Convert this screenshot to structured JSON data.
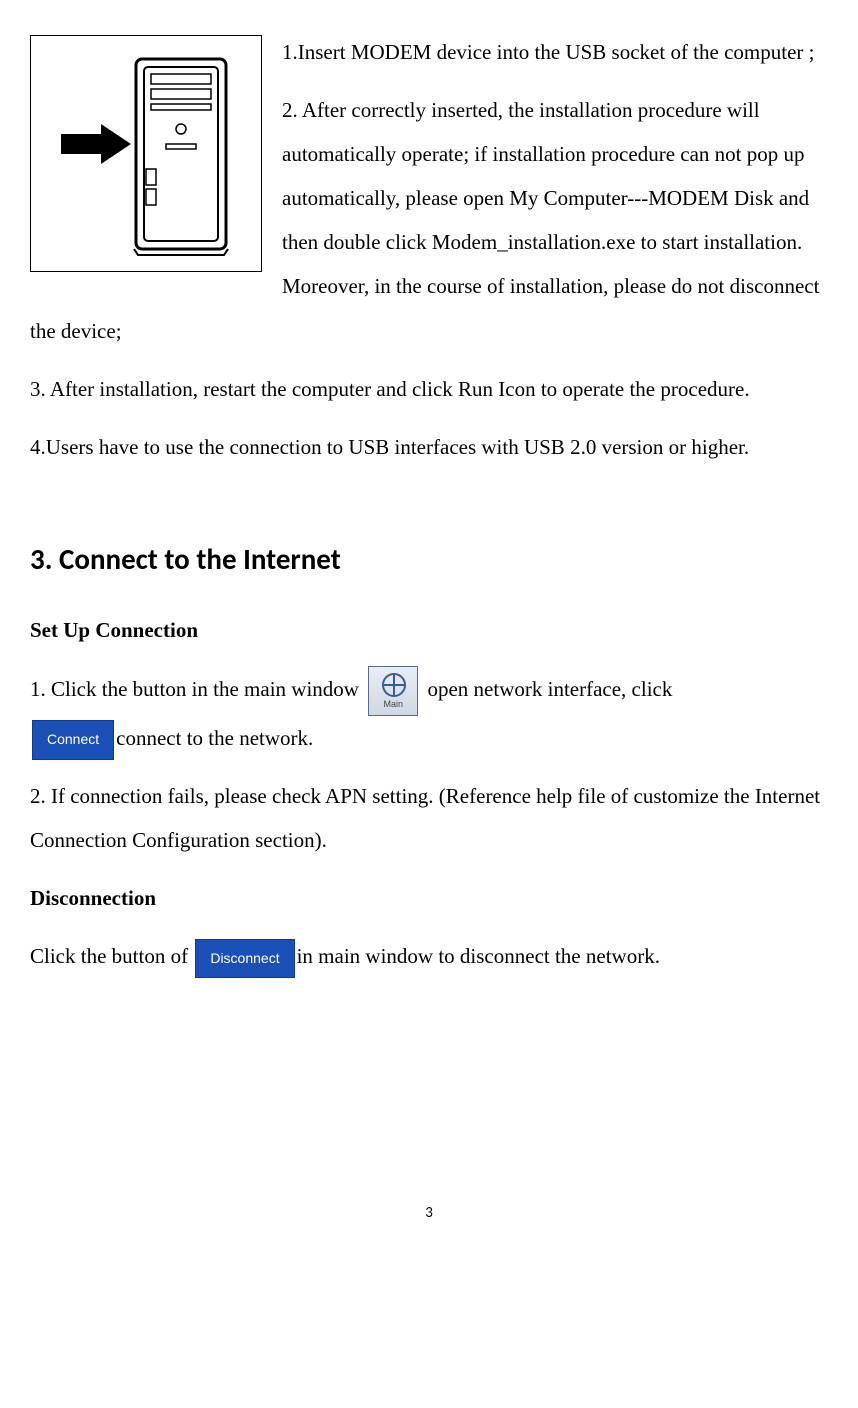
{
  "step1": "1.Insert MODEM device into the USB socket of the computer ;",
  "step2": "2. After correctly inserted, the installation procedure will automatically operate; if installation procedure can not pop up automatically, please open My Computer---MODEM Disk and then double click Modem_installation.exe to start installation. Moreover, in the course of installation, please do not disconnect the device;",
  "step3": "3. After installation, restart the computer and click Run Icon to operate the procedure.",
  "step4": "4.Users have to use the connection to USB interfaces with USB 2.0 version or higher.",
  "section_title": "3. Connect to the Internet",
  "subheading1": "Set Up Connection",
  "connect_step1_a": "1. Click the button in the main window ",
  "connect_step1_b": " open network interface, click ",
  "connect_btn_label": "Connect",
  "connect_step1_c": "connect to the network.",
  "connect_step2": "2. If connection fails, please check APN setting. (Reference help file of customize the Internet Connection Configuration section).",
  "subheading2": "Disconnection",
  "disconnect_text_a": "Click the button of ",
  "disconnect_btn_label": "Disconnect",
  "disconnect_text_b": "in main window to disconnect the network.",
  "page_number": "3"
}
